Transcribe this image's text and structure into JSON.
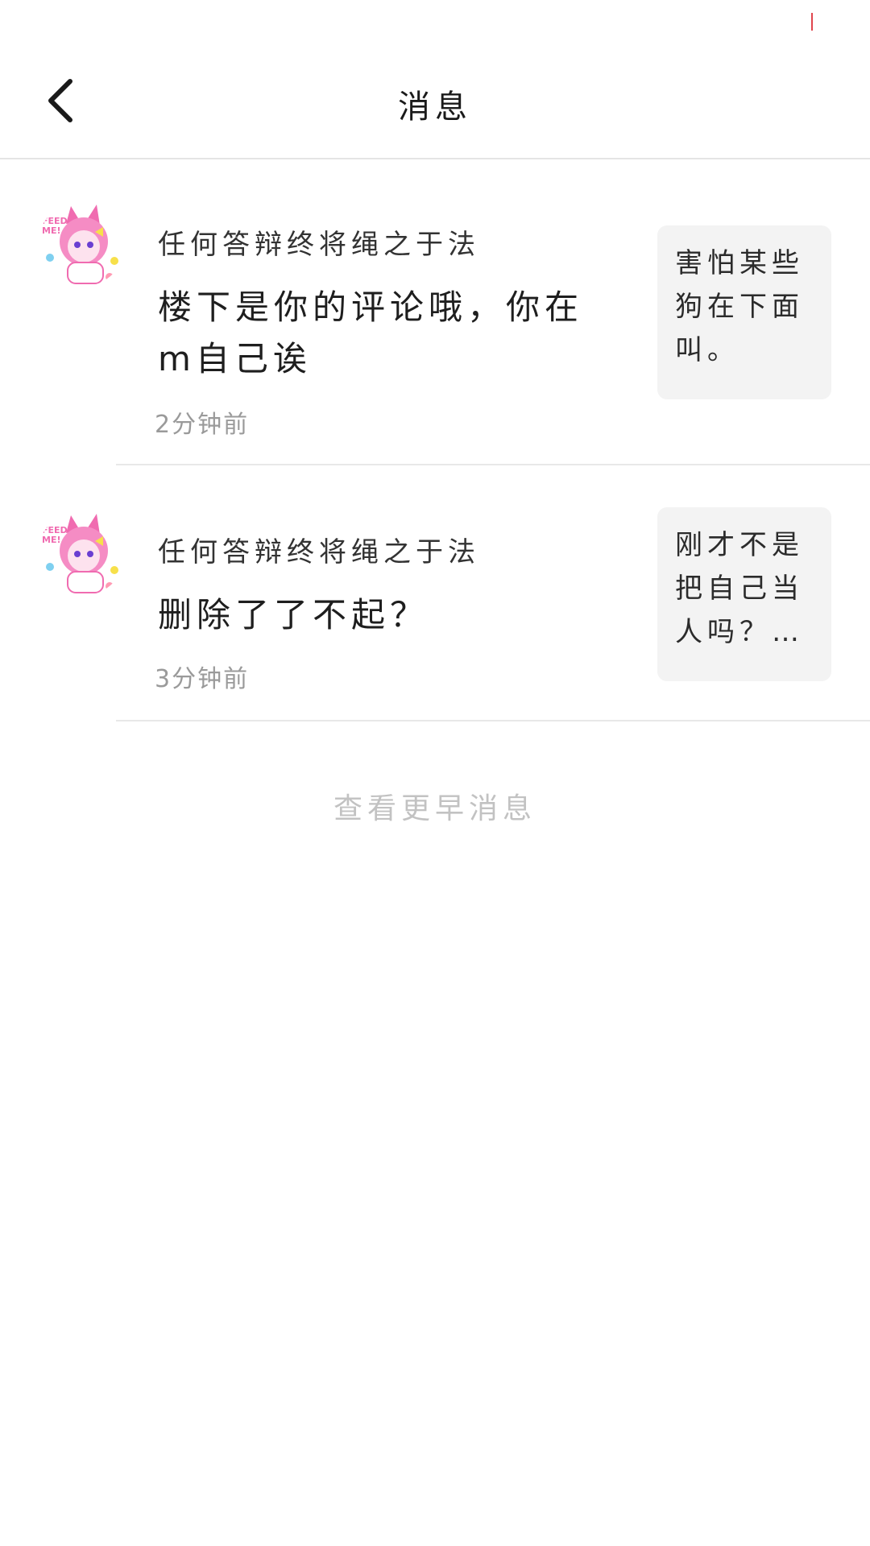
{
  "header": {
    "title": "消息",
    "back_icon": "chevron-left-icon"
  },
  "messages": [
    {
      "author": "任何答辩终将绳之于法",
      "text": "楼下是你的评论哦，你在m自己诶",
      "time": "2分钟前",
      "quoted": "害怕某些狗在下面叫。"
    },
    {
      "author": "任何答辩终将绳之于法",
      "text": "删除了了不起？",
      "time": "3分钟前",
      "quoted": "刚才不是把自己当人吗？…"
    }
  ],
  "load_more": "查看更早消息",
  "colors": {
    "accent_tick": "#e0464e",
    "divider": "#e8e8e8",
    "quote_bg": "#f3f3f3",
    "muted_text": "#9a9a9a"
  }
}
